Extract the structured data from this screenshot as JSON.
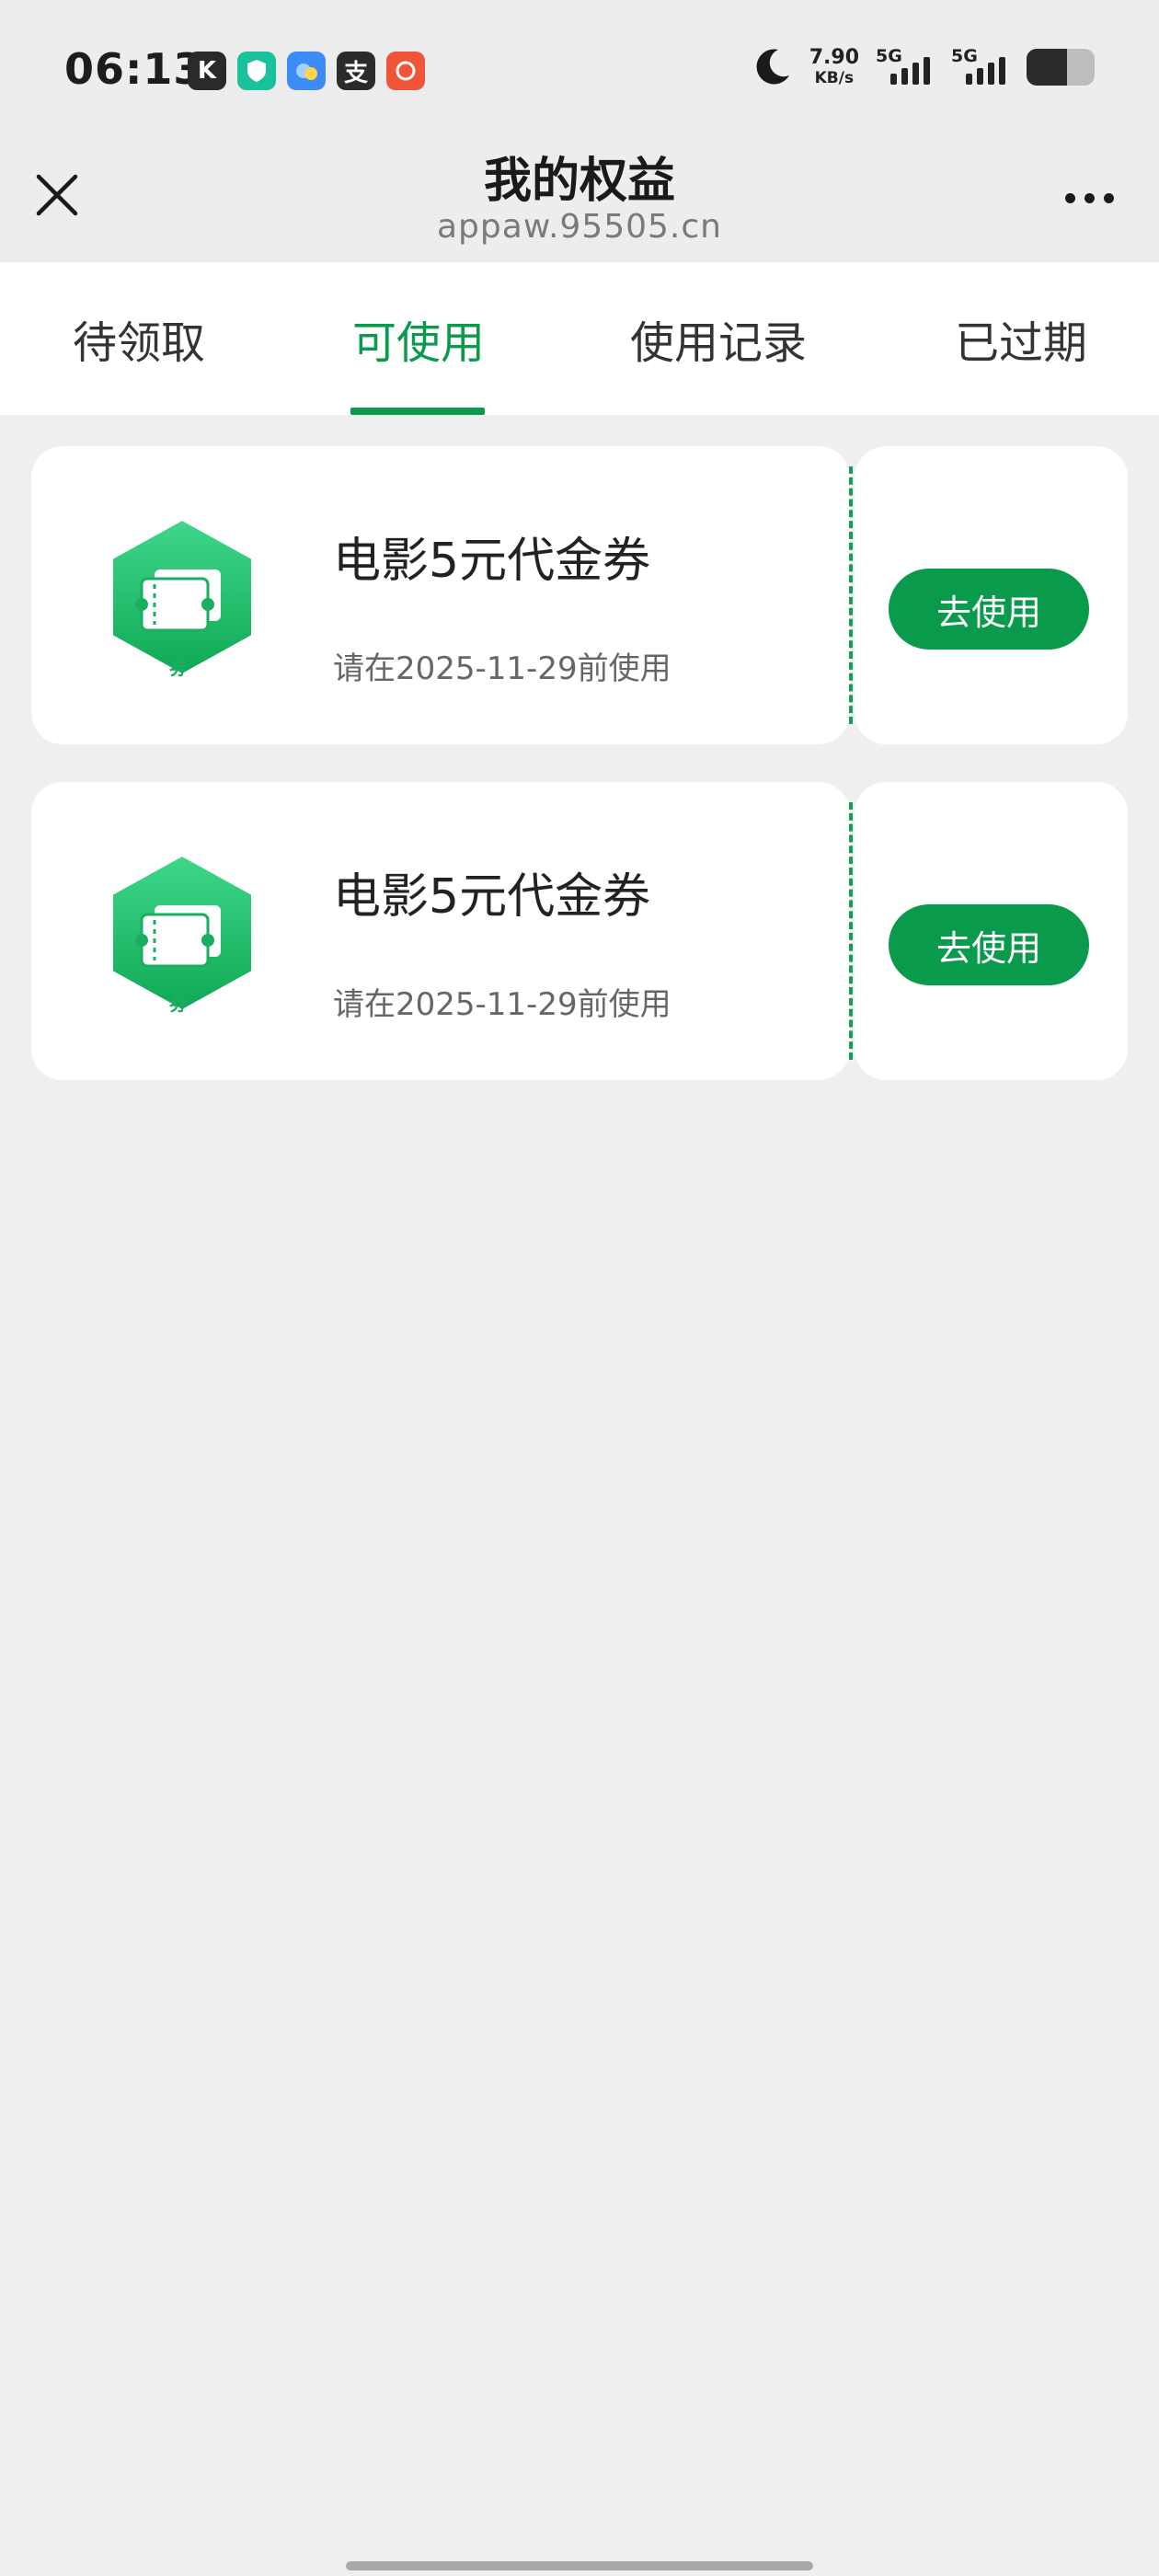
{
  "status_bar": {
    "time": "06:13",
    "network_speed_value": "7.90",
    "network_speed_unit": "KB/s",
    "sim1_label": "5G",
    "sim2_label": "5G",
    "battery_level_fraction": 0.6
  },
  "header": {
    "title": "我的权益",
    "subtitle": "appaw.95505.cn"
  },
  "tabs": [
    {
      "label": "待领取",
      "active": false
    },
    {
      "label": "可使用",
      "active": true
    },
    {
      "label": "使用记录",
      "active": false
    },
    {
      "label": "已过期",
      "active": false
    }
  ],
  "coupons": [
    {
      "title": "电影5元代金券",
      "expiry": "请在2025-11-29前使用",
      "button_label": "去使用",
      "icon_label": "券"
    },
    {
      "title": "电影5元代金券",
      "expiry": "请在2025-11-29前使用",
      "button_label": "去使用",
      "icon_label": "券"
    }
  ],
  "colors": {
    "accent": "#0a9a4c",
    "page_background": "#efefef"
  },
  "icons": [
    "close-icon",
    "more-icon",
    "moon-icon",
    "coupon-icon"
  ]
}
